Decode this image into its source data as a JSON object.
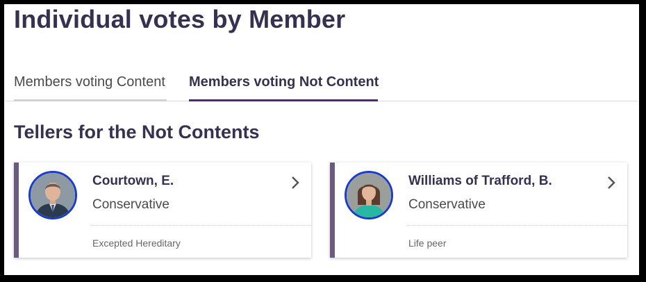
{
  "page": {
    "title": "Individual votes by Member"
  },
  "tabs": [
    {
      "label": "Members voting Content",
      "active": false
    },
    {
      "label": "Members voting Not Content",
      "active": true
    }
  ],
  "section": {
    "title": "Tellers for the Not Contents"
  },
  "members": [
    {
      "name": "Courtown, E.",
      "party": "Conservative",
      "peerage": "Excepted Hereditary",
      "icon": "chevron-right-icon"
    },
    {
      "name": "Williams of Trafford, B.",
      "party": "Conservative",
      "peerage": "Life peer",
      "icon": "chevron-right-icon"
    }
  ],
  "colors": {
    "accent": "#4d2c6e",
    "party_bar": "#6a5a7f",
    "avatar_ring": "#1b3cc8",
    "heading": "#373151"
  }
}
